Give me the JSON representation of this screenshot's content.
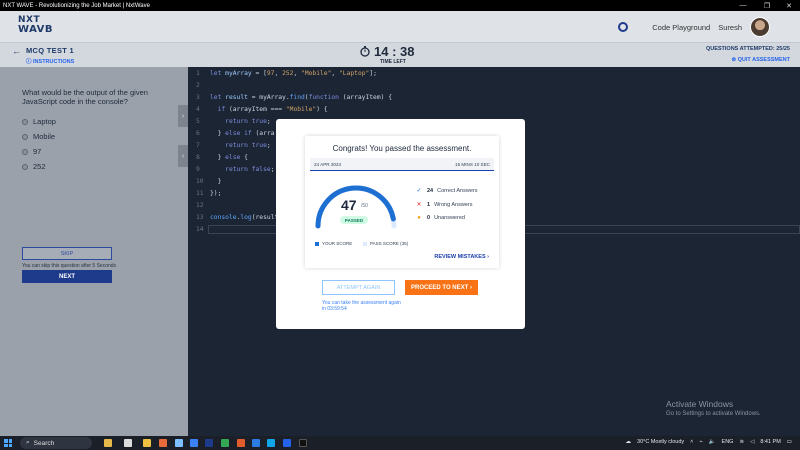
{
  "window": {
    "title": "NXT WAVE - Revolutionizing the Job Market | NxtWave"
  },
  "header": {
    "logo_line1": "NXT",
    "logo_line2": "WAVB",
    "code_playground": "Code Playground",
    "user_name": "Suresh"
  },
  "test": {
    "name": "MCQ TEST 1",
    "instructions": "INSTRUCTIONS",
    "timer": "14 : 38",
    "time_left_label": "TIME LEFT",
    "questions_attempted": "QUESTIONS ATTEMPTED: 25/25",
    "quit": "QUIT ASSESSMENT"
  },
  "question": {
    "text": "What would be the output of the given JavaScript code in the console?",
    "options": [
      "Laptop",
      "Mobile",
      "97",
      "252"
    ],
    "skip_label": "SKIP",
    "skip_note": "You can skip this question after 5 Seconds",
    "next_label": "NEXT"
  },
  "code": {
    "line_numbers": [
      "1",
      "2",
      "3",
      "4",
      "5",
      "6",
      "7",
      "8",
      "9",
      "10",
      "11",
      "12",
      "13",
      "14"
    ]
  },
  "result": {
    "heading": "Congrats! You passed the assessment.",
    "date": "24 APR 2024",
    "duration": "15 MINS 10 SEC",
    "score": "47",
    "max_score": "/50",
    "score_fraction": 0.94,
    "status": "PASSED",
    "legend_your_score": "YOUR SCORE",
    "legend_pass_score": "PASS SCORE (35)",
    "correct_count": "24",
    "correct_label": "Correct Answers",
    "wrong_count": "1",
    "wrong_label": "Wrong Answers",
    "unanswered_count": "0",
    "unanswered_label": "Unanswered",
    "review_label": "REVIEW MISTAKES",
    "attempt_again_label": "ATTEMPT AGAIN",
    "attempt_note": "You can take the assessment again in 03:59:54",
    "proceed_label": "PROCEED TO NEXT"
  },
  "watermark": {
    "line1": "Activate Windows",
    "line2": "Go to Settings to activate Windows."
  },
  "taskbar": {
    "search": "Search",
    "weather": "30°C  Mostly cloudy",
    "language": "ENG",
    "time": "8:41 PM"
  },
  "colors": {
    "accent": "#1e3a8a",
    "orange": "#f97316",
    "passed_green": "#047857",
    "gauge_blue": "#1d6fd1"
  }
}
